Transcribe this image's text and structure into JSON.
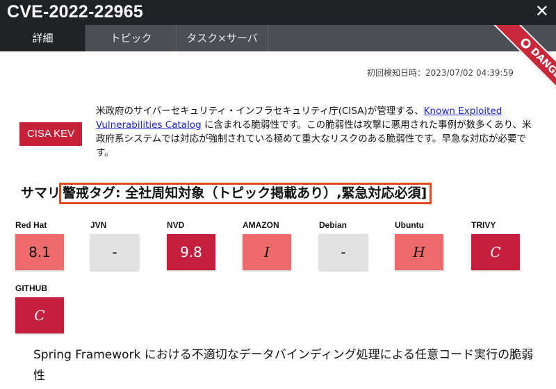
{
  "window": {
    "title": "CVE-2022-22965",
    "close_glyph": "✕"
  },
  "tabs": [
    {
      "label": "詳細",
      "active": true
    },
    {
      "label": "トピック",
      "active": false
    },
    {
      "label": "タスク×サーバ",
      "active": false
    }
  ],
  "ribbon": {
    "label": "DANGER",
    "color": "#c8283a"
  },
  "first_detected": "初回検知日時：2023/07/02 04:39:59",
  "cisa": {
    "badge": "CISA KEV",
    "text_before": "米政府のサイバーセキュリティ・インフラセキュリティ庁(CISA)が管理する、",
    "link": "Known Exploited Vulnerabilities Catalog",
    "text_after": " に含まれる脆弱性です。この脆弱性は攻撃に悪用された事例が数多くあり、米政府系システムでは対応が強制されている極めて重大なリスクのある脆弱性です。早急な対応が必要です。"
  },
  "summary": {
    "label": "サマリ",
    "tags": "警戒タグ: 全社周知対象（トピック掲載あり）,緊急対応必須]"
  },
  "scores": [
    {
      "source": "Red Hat",
      "value": "8.1",
      "bg": "#ee6b6b",
      "fg": "#111111"
    },
    {
      "source": "JVN",
      "value": "-",
      "bg": "#e2e2e2",
      "fg": "#111111"
    },
    {
      "source": "NVD",
      "value": "9.8",
      "bg": "#c41f3f",
      "fg": "#ffffff"
    },
    {
      "source": "AMAZON",
      "value": "I",
      "bg": "#ee6b6b",
      "fg": "#111111"
    },
    {
      "source": "Debian",
      "value": "-",
      "bg": "#e2e2e2",
      "fg": "#111111"
    },
    {
      "source": "Ubuntu",
      "value": "H",
      "bg": "#ee6b6b",
      "fg": "#111111"
    },
    {
      "source": "TRIVY",
      "value": "C",
      "bg": "#c41f3f",
      "fg": "#ffffff"
    },
    {
      "source": "GITHUB",
      "value": "C",
      "bg": "#c41f3f",
      "fg": "#ffffff"
    }
  ],
  "description": "Spring Framework における不適切なデータバインディング処理による任意コード実行の脆弱性"
}
